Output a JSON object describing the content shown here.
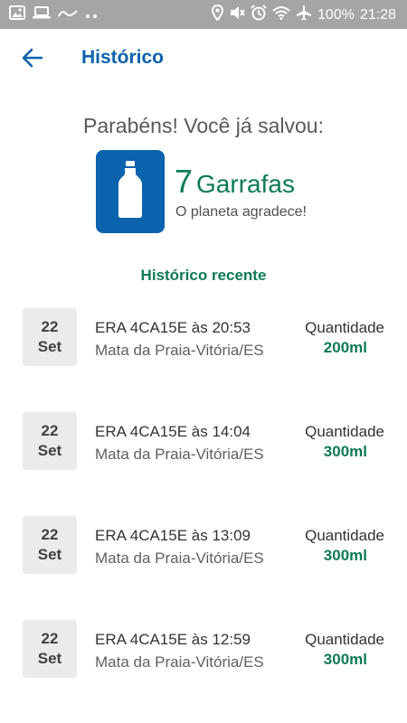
{
  "status_bar": {
    "battery": "100%",
    "time": "21:28",
    "icons": [
      "image-icon",
      "laptop-icon",
      "app-icon",
      "more-dots-icon",
      "location-icon",
      "mute-icon",
      "alarm-icon",
      "wifi-icon",
      "airplane-icon"
    ]
  },
  "header": {
    "title": "Histórico",
    "back_icon": "back-arrow-icon"
  },
  "summary": {
    "congrats": "Parabéns! Você já salvou:",
    "bottle_icon": "bottle-icon",
    "count": "7",
    "unit": "Garrafas",
    "subtitle": "O planeta agradece!"
  },
  "recent": {
    "title": "Histórico recente",
    "items": [
      {
        "day": "22",
        "month": "Set",
        "title": "ERA 4CA15E às 20:53",
        "location": "Mata da Praia-Vitória/ES",
        "qty_label": "Quantidade",
        "qty_value": "200ml"
      },
      {
        "day": "22",
        "month": "Set",
        "title": "ERA 4CA15E às 14:04",
        "location": "Mata da Praia-Vitória/ES",
        "qty_label": "Quantidade",
        "qty_value": "300ml"
      },
      {
        "day": "22",
        "month": "Set",
        "title": "ERA 4CA15E às 13:09",
        "location": "Mata da Praia-Vitória/ES",
        "qty_label": "Quantidade",
        "qty_value": "300ml"
      },
      {
        "day": "22",
        "month": "Set",
        "title": "ERA 4CA15E às 12:59",
        "location": "Mata da Praia-Vitória/ES",
        "qty_label": "Quantidade",
        "qty_value": "300ml"
      }
    ]
  },
  "colors": {
    "primary_blue": "#0b62ad",
    "accent_green": "#0e7a55",
    "status_bar": "#a5a5a5"
  }
}
